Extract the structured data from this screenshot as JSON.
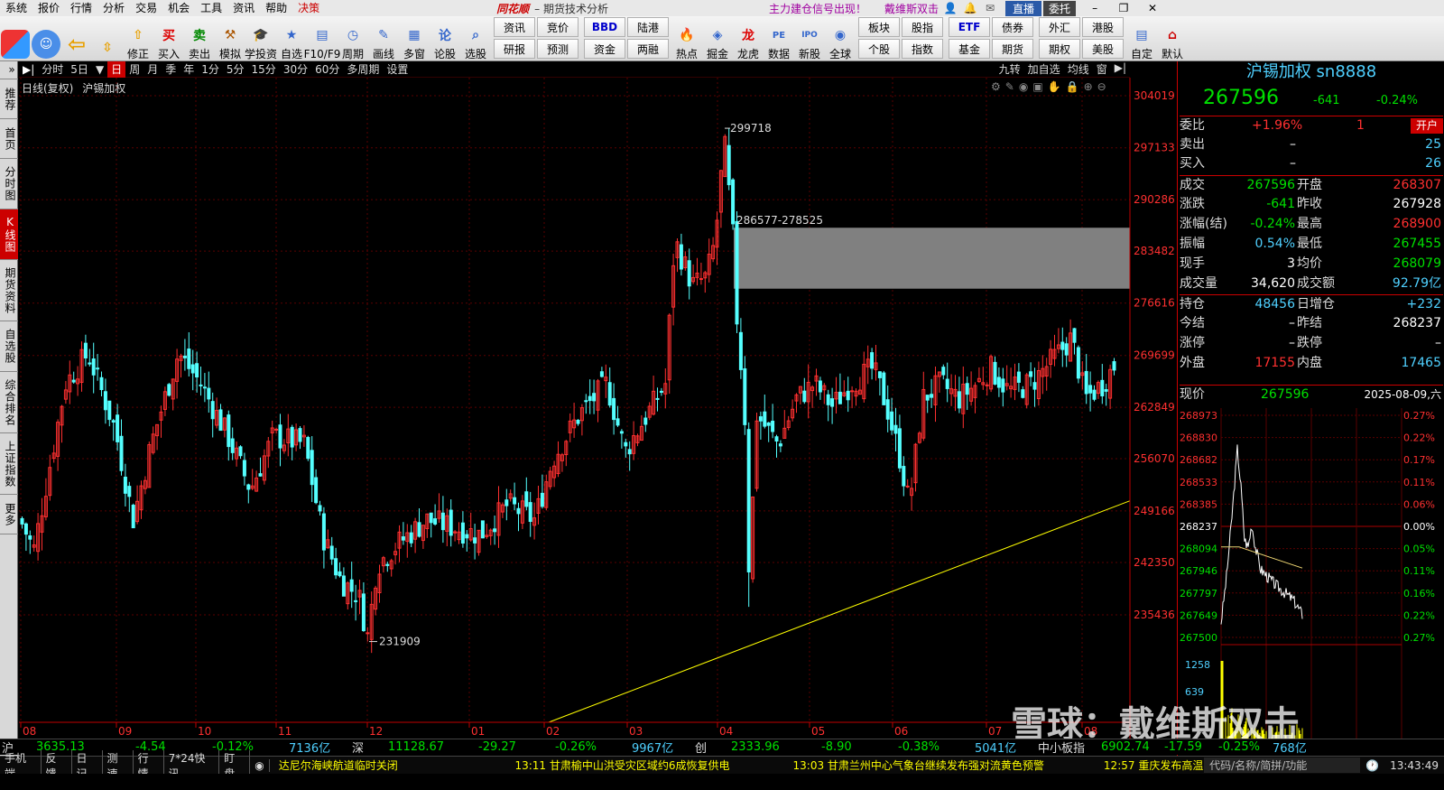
{
  "menubar": {
    "items": [
      "系统",
      "报价",
      "行情",
      "分析",
      "交易",
      "机会",
      "工具",
      "资讯",
      "帮助"
    ],
    "decision": "决策",
    "brand": "同花顺",
    "subtitle": "– 期货技术分析",
    "ad1": "主力建仓信号出现！",
    "ad2": "戴维斯双击",
    "live": "直播",
    "delegate": "委托"
  },
  "toolbar": {
    "buttons": [
      {
        "label": "修正",
        "icon": "⇧"
      },
      {
        "label": "买入",
        "icon": "买"
      },
      {
        "label": "卖出",
        "icon": "卖"
      },
      {
        "label": "模拟",
        "icon": "⚒"
      },
      {
        "label": "学投资",
        "icon": "🎓"
      },
      {
        "label": "自选",
        "icon": "★"
      },
      {
        "label": "F10/F9",
        "icon": "▤"
      },
      {
        "label": "周期",
        "icon": "◷"
      },
      {
        "label": "画线",
        "icon": "✎"
      },
      {
        "label": "多窗",
        "icon": "▦"
      },
      {
        "label": "论股",
        "icon": "论"
      },
      {
        "label": "选股",
        "icon": "⌕"
      }
    ],
    "grid1": [
      "资讯",
      "竞价",
      "BBD",
      "陆港",
      "研报",
      "预测",
      "资金",
      "两融"
    ],
    "buttons2": [
      {
        "label": "热点",
        "icon": "🔥"
      },
      {
        "label": "掘金",
        "icon": "◈"
      },
      {
        "label": "龙虎",
        "icon": "龙"
      },
      {
        "label": "数据",
        "icon": "PE"
      },
      {
        "label": "新股",
        "icon": "IPO"
      },
      {
        "label": "全球",
        "icon": "◉"
      }
    ],
    "grid2": [
      "板块",
      "股指",
      "ETF",
      "债券",
      "外汇",
      "港股",
      "个股",
      "指数",
      "基金",
      "期货",
      "期权",
      "美股"
    ],
    "custom": "自定",
    "default": "默认"
  },
  "lefttabs": [
    "推荐",
    "首页",
    "分时图",
    "K线图",
    "期货资料",
    "自选股",
    "综合排名",
    "上证指数",
    "更多"
  ],
  "periodbar": {
    "items": [
      "分时",
      "5日",
      "日",
      "周",
      "月",
      "季",
      "年",
      "1分",
      "5分",
      "15分",
      "30分",
      "60分",
      "多周期",
      "设置"
    ],
    "active": "日",
    "right": [
      "九转",
      "加自选",
      "均线",
      "窗"
    ]
  },
  "chartinfo": {
    "label": "日线(复权)",
    "name": "沪锡加权"
  },
  "annotations": {
    "high": "299718",
    "low": "231909",
    "gap": "286577-278525"
  },
  "axis": {
    "prices": [
      "304019",
      "297133",
      "290286",
      "283482",
      "276616",
      "269699",
      "262849",
      "256070",
      "249166",
      "242350",
      "235436"
    ],
    "months": [
      "08",
      "09",
      "10",
      "11",
      "12",
      "01",
      "02",
      "03",
      "04",
      "05",
      "06",
      "07",
      "08"
    ]
  },
  "quote": {
    "title": "沪锡加权 sn8888",
    "price": "267596",
    "change": "-641",
    "pct": "-0.24%",
    "weibi_label": "委比",
    "weibi": "+1.96%",
    "weicha": "1",
    "open_btn": "开户",
    "sell_label": "卖出",
    "sell": "–",
    "sell_vol": "25",
    "buy_label": "买入",
    "buy": "–",
    "buy_vol": "26",
    "rows": [
      {
        "l1": "成交",
        "v1": "267596",
        "c1": "grn",
        "l2": "开盘",
        "v2": "268307",
        "c2": "red"
      },
      {
        "l1": "涨跌",
        "v1": "-641",
        "c1": "grn",
        "l2": "昨收",
        "v2": "267928",
        "c2": "wht"
      },
      {
        "l1": "涨幅(结)",
        "v1": "-0.24%",
        "c1": "grn",
        "l2": "最高",
        "v2": "268900",
        "c2": "red"
      },
      {
        "l1": "振幅",
        "v1": "0.54%",
        "c1": "cyan",
        "l2": "最低",
        "v2": "267455",
        "c2": "grn"
      },
      {
        "l1": "现手",
        "v1": "3",
        "c1": "wht",
        "l2": "均价",
        "v2": "268079",
        "c2": "grn"
      },
      {
        "l1": "成交量",
        "v1": "34,620",
        "c1": "wht",
        "l2": "成交额",
        "v2": "92.79亿",
        "c2": "cyan"
      },
      {
        "l1": "持仓",
        "v1": "48456",
        "c1": "cyan",
        "l2": "日增仓",
        "v2": "+232",
        "c2": "cyan"
      },
      {
        "l1": "今结",
        "v1": "–",
        "c1": "wht",
        "l2": "昨结",
        "v2": "268237",
        "c2": "wht"
      },
      {
        "l1": "涨停",
        "v1": "–",
        "c1": "wht",
        "l2": "跌停",
        "v2": "–",
        "c2": "wht"
      },
      {
        "l1": "外盘",
        "v1": "17155",
        "c1": "red",
        "l2": "内盘",
        "v2": "17465",
        "c2": "cyan"
      }
    ],
    "mini_label": "现价",
    "mini_price": "267596",
    "mini_date": "2025-08-09,六",
    "mini_prices": [
      "268973",
      "268830",
      "268682",
      "268533",
      "268385",
      "268237",
      "268094",
      "267946",
      "267797",
      "267649",
      "267500"
    ],
    "mini_pcts": [
      "0.27%",
      "0.22%",
      "0.17%",
      "0.11%",
      "0.06%",
      "0.00%",
      "0.05%",
      "0.11%",
      "0.16%",
      "0.22%",
      "0.27%"
    ],
    "mini_vols": [
      "1258",
      "639"
    ]
  },
  "indexbar": {
    "sh_label": "沪",
    "sh": "3635.13",
    "sh_chg": "-4.54",
    "sh_pct": "-0.12%",
    "sh_amt": "7136亿",
    "sz_label": "深",
    "sz": "11128.67",
    "sz_chg": "-29.27",
    "sz_pct": "-0.26%",
    "sz_amt": "9967亿",
    "cy_label": "创",
    "cy": "2333.96",
    "cy_chg": "-8.90",
    "cy_pct": "-0.38%",
    "cy_amt": "5041亿",
    "zx_label": "中小板指",
    "zx": "6902.74",
    "zx_chg": "-17.59",
    "zx_pct": "-0.25%",
    "zx_amt": "768亿"
  },
  "newsbar": {
    "tabs": [
      "手机端",
      "反馈",
      "日记",
      "测速",
      "行情",
      "7*24快讯",
      "盯盘"
    ],
    "news": [
      "达尼尔海峡航道临时关闭",
      "13:11 甘肃榆中山洪受灾区域约6成恢复供电",
      "13:03 甘肃兰州中心气象台继续发布强对流黄色预警",
      "12:57 重庆发布高温"
    ],
    "search": "代码/名称/简拼/功能",
    "clock": "13:43:49"
  },
  "watermark": "雪球：戴维斯双击",
  "colors": {
    "up": "#ff3030",
    "down": "#54ffff",
    "axis": "#c00000",
    "trend": "#ffff00"
  }
}
